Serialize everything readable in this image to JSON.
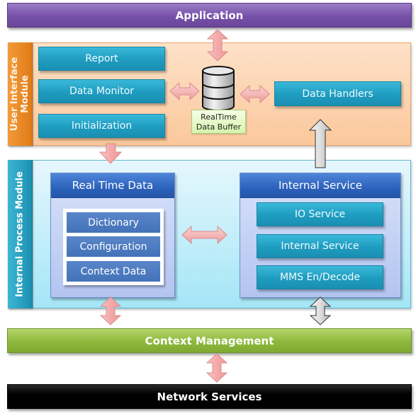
{
  "diagram": {
    "application": "Application",
    "user_interface_module": {
      "label_line1": "User Interface",
      "label_line2": "Module",
      "buttons": [
        "Report",
        "Data Monitor",
        "Initialization"
      ],
      "buffer": {
        "line1": "RealTime",
        "line2": "Data Buffer"
      },
      "data_handlers": "Data Handlers"
    },
    "internal_process_module": {
      "label": "Internal Process Module",
      "real_time_data": {
        "title": "Real Time Data",
        "items": [
          "Dictionary",
          "Configuration",
          "Context Data"
        ]
      },
      "internal_service": {
        "title": "Internal Service",
        "items": [
          "IO Service",
          "Internal Service",
          "MMS En/Decode"
        ]
      }
    },
    "context_management": "Context Management",
    "network_services": "Network Services"
  },
  "colors": {
    "application": "#7650a8",
    "ui_module": "#fbc89c",
    "ui_side": "#e07c16",
    "ip_module": "#a4e6f7",
    "ip_side": "#1c8fb0",
    "context_management": "#8db83d",
    "network_services": "#000000",
    "pink_arrow": "#f6b3b3",
    "gray_arrow": "#d4d4d4"
  }
}
